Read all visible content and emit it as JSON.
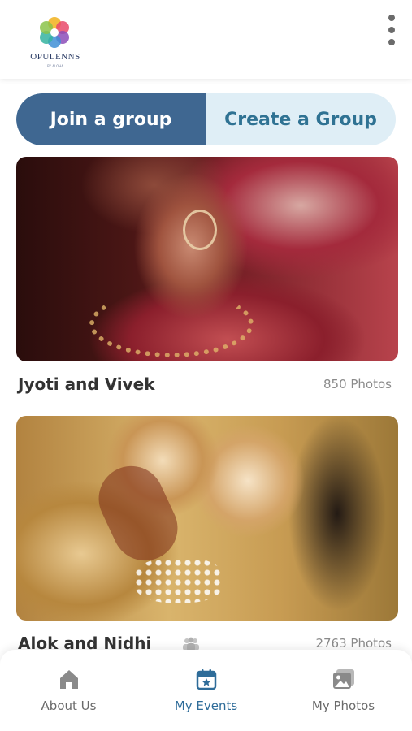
{
  "brand": {
    "name": "OPULENNS",
    "sub": "BY ALOHA"
  },
  "header": {
    "menu_icon": "kebab-menu-icon"
  },
  "segmented": {
    "join_label": "Join a group",
    "create_label": "Create a Group",
    "active": "join"
  },
  "events": [
    {
      "name": "Jyoti and Vivek",
      "count": "850 Photos"
    },
    {
      "name": "Alok and Nidhi",
      "count": "2763 Photos"
    }
  ],
  "bottom_nav": [
    {
      "label": "About Us",
      "icon": "home-icon",
      "active": false
    },
    {
      "label": "My Events",
      "icon": "calendar-star-icon",
      "active": true
    },
    {
      "label": "My Photos",
      "icon": "photos-icon",
      "active": false
    }
  ],
  "colors": {
    "primary": "#3f6791",
    "accent": "#2f7293",
    "segment_bg": "#dfeef6",
    "nav_active": "#2e6c99"
  }
}
